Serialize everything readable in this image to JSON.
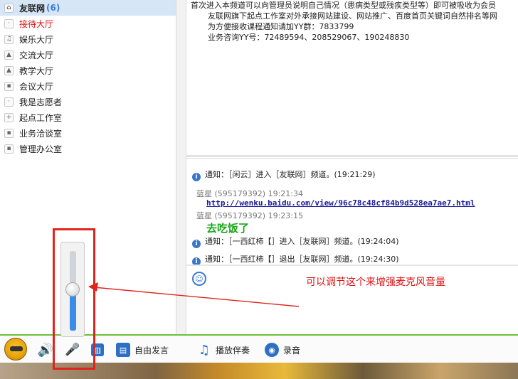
{
  "sidebar": {
    "items": [
      {
        "label": "友联网",
        "count": "(6)",
        "icon": "home-icon"
      },
      {
        "label": "接待大厅",
        "icon": "dot-icon"
      },
      {
        "label": "娱乐大厅",
        "icon": "music-icon"
      },
      {
        "label": "交流大厅",
        "icon": "cap-icon"
      },
      {
        "label": "教学大厅",
        "icon": "cap-icon"
      },
      {
        "label": "会议大厅",
        "icon": "lock-icon"
      },
      {
        "label": "我是志愿者",
        "icon": "dot-icon"
      },
      {
        "label": "起点工作室",
        "icon": "plus-icon"
      },
      {
        "label": "业务洽谈室",
        "icon": "lock-icon"
      },
      {
        "label": "管理办公室",
        "icon": "lock-icon"
      }
    ]
  },
  "notice": {
    "line1": "首次进入本频道可以向管理员说明自己情况（患病类型或残疾类型等）即可被吸收为会员",
    "line2": "友联网旗下起点工作室对外承接网站建设、网站推广、百度首页关键词自然排名等网",
    "line3": "为方便接收课程通知请加YY群：7833799",
    "line4": "业务咨询YY号：72489594、208529067、190248830"
  },
  "chat": {
    "notify1": "通知：［闲云］进入［友联网］频道。(19:21:29)",
    "msg1_sender": "蓝星",
    "msg1_id": "(595179392)",
    "msg1_time": "19:21:34",
    "msg1_link": "http://wenku.baidu.com/view/96c78c48cf84b9d528ea7ae7.html",
    "msg2_sender": "蓝星",
    "msg2_id": "(595179392)",
    "msg2_time": "19:23:15",
    "msg2_text": "去吃饭了",
    "notify2": "通知：［一西红柿【］进入［友联网］频道。(19:24:04)",
    "notify3": "通知：［一西红柿【］退出［友联网］频道。(19:24:30)"
  },
  "annotation": {
    "text": "可以调节这个来增强麦克风音量"
  },
  "toolbar": {
    "free_speech": "自由发言",
    "play_accompaniment": "播放伴奏",
    "record": "录音"
  },
  "volume_slider": {
    "level_percent": 52
  },
  "colors": {
    "accent": "#3b76c7",
    "annotation_red": "#e0241c",
    "link": "#1a1a9a",
    "message_green": "#1aa61a",
    "toolbar_green": "#6fbf3a"
  }
}
